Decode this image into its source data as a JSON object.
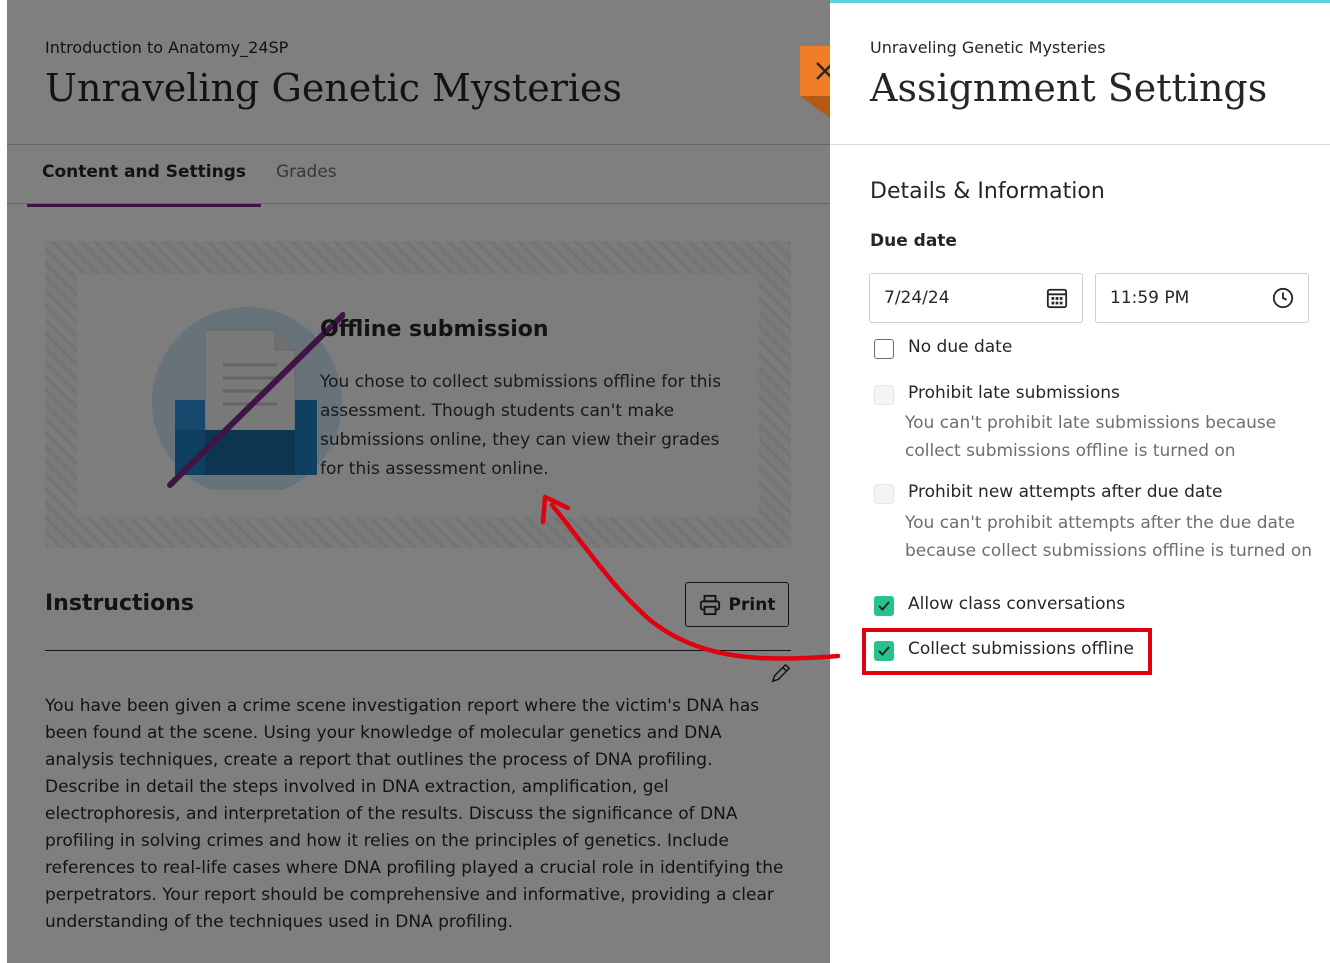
{
  "left": {
    "course": "Introduction to Anatomy_24SP",
    "title": "Unraveling Genetic Mysteries",
    "tabs": [
      "Content and Settings",
      "Grades"
    ],
    "offline_title": "Offline submission",
    "offline_body": "You chose to collect submissions offline for this assessment. Though students can't make submissions online, they can view their grades for this assessment online.",
    "instructions_title": "Instructions",
    "print_label": "Print",
    "instructions_body": "You have been given a crime scene investigation report where the victim's DNA has been found at the scene. Using your knowledge of molecular genetics and DNA analysis techniques, create a report that outlines the process of DNA profiling. Describe in detail the steps involved in DNA extraction, amplification, gel electrophoresis, and interpretation of the results. Discuss the significance of DNA profiling in solving crimes and how it relies on the principles of genetics. Include references to real-life cases where DNA profiling played a crucial role in identifying the perpetrators. Your report should be comprehensive and informative, providing a clear understanding of the techniques used in DNA profiling."
  },
  "panel": {
    "subtitle": "Unraveling Genetic Mysteries",
    "title": "Assignment Settings",
    "section": "Details & Information",
    "due_label": "Due date",
    "date_value": "7/24/24",
    "time_value": "11:59 PM",
    "no_due_date": "No due date",
    "prohibit_late": "Prohibit late submissions",
    "prohibit_late_help": "You can't prohibit late submissions because collect submissions offline is turned on",
    "prohibit_attempts": "Prohibit new attempts after due date",
    "prohibit_attempts_help": "You can't prohibit attempts after the due date because collect submissions offline is turned on",
    "allow_conversations": "Allow class conversations",
    "collect_offline": "Collect submissions offline"
  },
  "icons": {
    "close": "close-icon",
    "calendar": "calendar-icon",
    "clock": "clock-icon",
    "print": "printer-icon",
    "edit": "pencil-icon",
    "check": "checkmark-icon"
  },
  "colors": {
    "accent_tab": "#7c2a8a",
    "close_tab": "#f07e26",
    "checkbox_checked": "#28c38b",
    "highlight": "#e0000f",
    "panel_top": "#5fd1e0"
  }
}
